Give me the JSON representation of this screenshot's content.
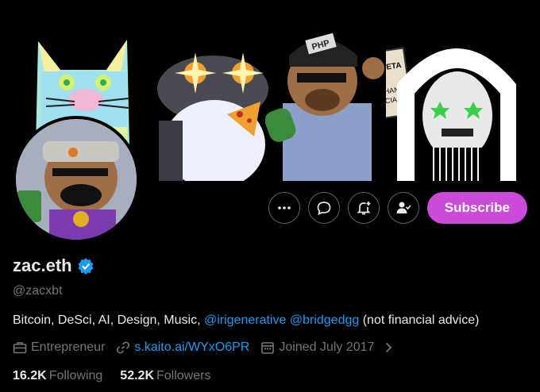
{
  "profile": {
    "name": "zac.eth",
    "handle": "@zacxbt",
    "bio": {
      "text1": "Bitcoin, DeSci, AI, Design, Music, ",
      "mention1": "@irigenerative",
      "mention2": "@bridgedgg",
      "text2": " (not financial advice)"
    },
    "meta": {
      "category": "Entrepreneur",
      "link": "s.kaito.ai/WYxO6PR",
      "joined": "Joined July 2017"
    },
    "stats": {
      "following_count": "16.2K",
      "following_label": "Following",
      "followers_count": "52.2K",
      "followers_label": "Followers"
    }
  },
  "actions": {
    "subscribe_label": "Subscribe",
    "more_icon": "more-icon",
    "message_icon": "message-icon",
    "notify_icon": "bell-plus-icon",
    "following_icon": "person-check-icon"
  },
  "banner_text": {
    "sign_line1": "MONETA",
    "sign_line2": "EXCHANGE",
    "sign_line3": "SPECIALIST",
    "cap_text": "PHP"
  },
  "colors": {
    "accent": "#1d9bf0",
    "subscribe": "#c94bd8",
    "muted": "#71767b"
  }
}
